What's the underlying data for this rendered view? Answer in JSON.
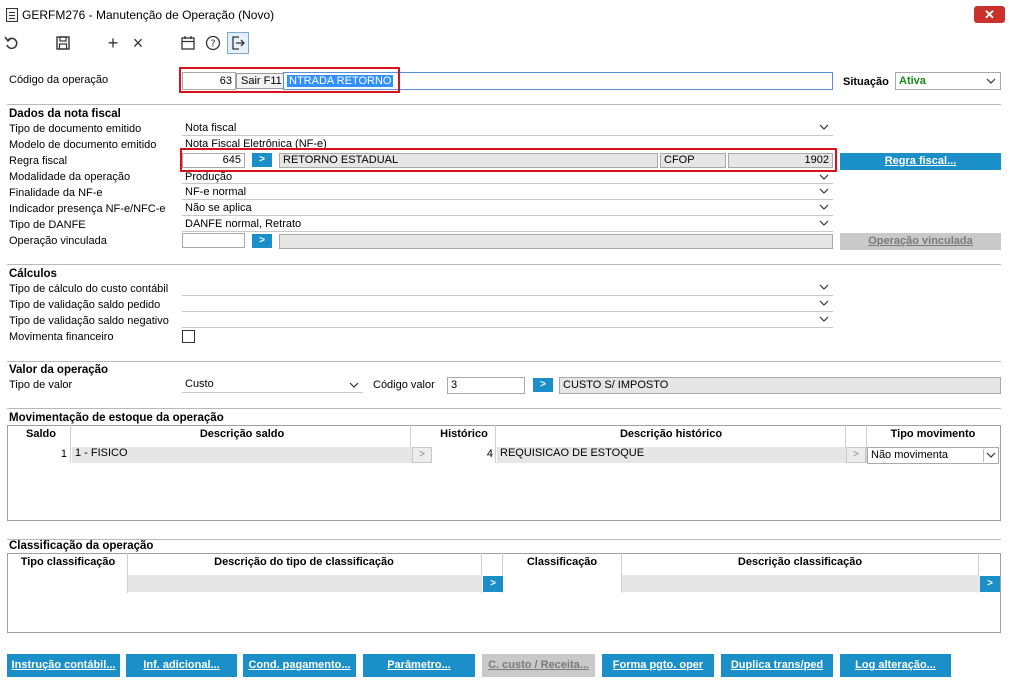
{
  "window": {
    "title": "GERFM276 - Manutenção de Operação (Novo)",
    "close": "✕"
  },
  "toolbar": {
    "undo": "undo-icon",
    "save": "save-icon",
    "add": "+",
    "remove": "×",
    "calendar": "calendar-icon",
    "help": "?",
    "exit": "exit-icon"
  },
  "header": {
    "codigo_label": "Código da operação",
    "codigo_value": "63",
    "tooltip": "Sair F11",
    "descricao_value": "NTRADA RETORNO",
    "situacao_label": "Situação",
    "situacao_value": "Ativa"
  },
  "nota_fiscal": {
    "title": "Dados da nota fiscal",
    "tipo_documento_label": "Tipo de documento emitido",
    "tipo_documento_value": "Nota fiscal",
    "modelo_label": "Modelo de documento emitido",
    "modelo_value": "Nota Fiscal Eletrônica (NF-e)",
    "regra_label": "Regra fiscal",
    "regra_code": "645",
    "regra_go": ">",
    "regra_desc": "RETORNO ESTADUAL",
    "cfop_label": "CFOP",
    "cfop_value": "1902",
    "regra_button": "Regra fiscal...",
    "modalidade_label": "Modalidade da operação",
    "modalidade_value": "Produção",
    "finalidade_label": "Finalidade da NF-e",
    "finalidade_value": "NF-e normal",
    "indicador_label": "Indicador presença NF-e/NFC-e",
    "indicador_value": "Não se aplica",
    "danfe_label": "Tipo de DANFE",
    "danfe_value": "DANFE normal, Retrato",
    "vinculada_label": "Operação vinculada",
    "vinculada_go": ">",
    "vinculada_button": "Operação vinculada"
  },
  "calculos": {
    "title": "Cálculos",
    "custo_label": "Tipo de cálculo do custo contábil",
    "saldo_pedido_label": "Tipo de validação saldo pedido",
    "saldo_negativo_label": "Tipo de validação saldo negativo",
    "mov_financeiro_label": "Movimenta financeiro"
  },
  "valor": {
    "title": "Valor da operação",
    "tipo_label": "Tipo de valor",
    "tipo_value": "Custo",
    "codigo_label": "Código valor",
    "codigo_value": "3",
    "go": ">",
    "codigo_desc": "CUSTO S/ IMPOSTO"
  },
  "estoque": {
    "title": "Movimentação de estoque da operação",
    "columns": [
      "Saldo",
      "Descrição saldo",
      "Histórico",
      "Descrição histórico",
      "Tipo movimento"
    ],
    "row": {
      "saldo": "1",
      "desc_saldo": "1 - FISICO",
      "historico": "4",
      "desc_historico": "REQUISICAO DE ESTOQUE",
      "tipo": "Não movimenta",
      "arrow": ">"
    }
  },
  "classificacao": {
    "title": "Classificação da operação",
    "columns": [
      "Tipo classificação",
      "Descrição do tipo de classificação",
      "Classificação",
      "Descrição classificação"
    ],
    "arrow": ">"
  },
  "bottom_buttons": [
    "Instrução contábil...",
    "Inf. adicional...",
    "Cond. pagamento...",
    "Parâmetro...",
    "C. custo / Receita...",
    "Forma pgto. oper",
    "Duplica trans/ped",
    "Log alteração..."
  ],
  "colors": {
    "accent": "#1a8fc8",
    "highlight": "#d7121e",
    "active": "#128c12"
  }
}
